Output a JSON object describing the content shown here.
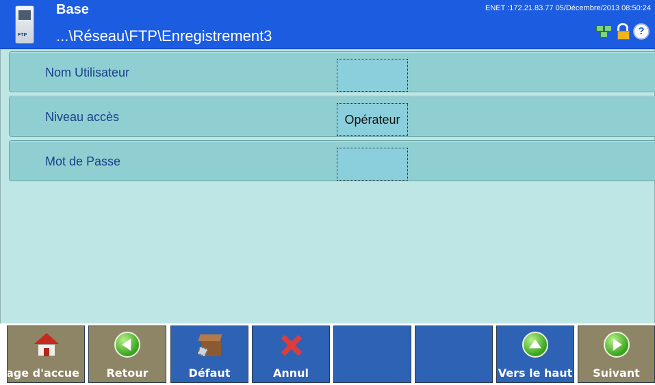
{
  "header": {
    "title": "Base",
    "path": "...\\Réseau\\FTP\\Enregistrement3",
    "status": "ENET :172.21.83.77  05/Décembre/2013 08:50:24",
    "icon_tag": "FTP"
  },
  "icons": {
    "header_device": "ftp-device-icon",
    "network": "network-status-icon",
    "lock": "unlocked-padlock-icon",
    "help": "help-icon"
  },
  "fields": [
    {
      "label": "Nom Utilisateur",
      "value": ""
    },
    {
      "label": "Niveau accès",
      "value": "Opérateur"
    },
    {
      "label": "Mot de Passe",
      "value": ""
    }
  ],
  "footer": {
    "buttons": [
      {
        "label": "age d'accue",
        "icon": "home-icon",
        "style": "tan"
      },
      {
        "label": "Retour",
        "icon": "back-arrow-icon",
        "style": "tan"
      },
      {
        "label": "Défaut",
        "icon": "default-box-icon",
        "style": "blue"
      },
      {
        "label": "Annul",
        "icon": "cancel-x-icon",
        "style": "blue"
      },
      {
        "label": "",
        "icon": "",
        "style": "blue"
      },
      {
        "label": "",
        "icon": "",
        "style": "blue"
      },
      {
        "label": "Vers le haut",
        "icon": "up-arrow-icon",
        "style": "blue"
      },
      {
        "label": "Suivant",
        "icon": "next-arrow-icon",
        "style": "tan"
      }
    ]
  },
  "colors": {
    "header_bg": "#1c5ce0",
    "content_bg": "#bde6e5",
    "row_bg": "#8fcfd2",
    "label_text": "#1a3f8a",
    "button_tan": "#8e8466",
    "button_blue": "#2e62b4"
  },
  "help_glyph": "?"
}
